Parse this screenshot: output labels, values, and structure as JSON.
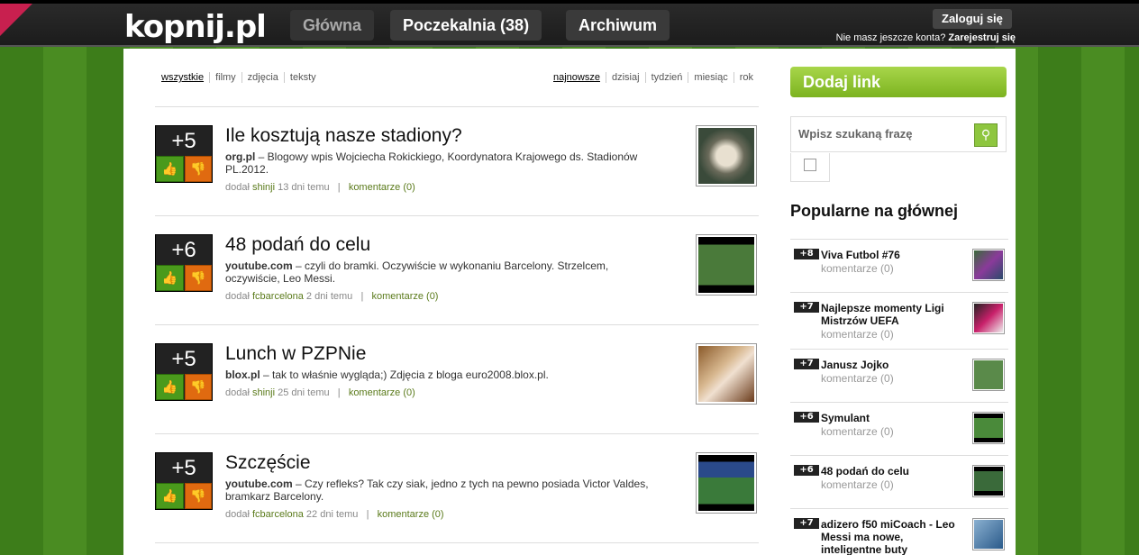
{
  "header": {
    "logo": "kopnij.pl",
    "nav": [
      "Główna",
      "Poczekalnia (38)",
      "Archiwum"
    ],
    "login": "Zaloguj się",
    "register_prefix": "Nie masz jeszcze konta?",
    "register_link": "Zarejestruj się"
  },
  "filters": {
    "type": [
      "wszystkie",
      "filmy",
      "zdjęcia",
      "teksty"
    ],
    "time": [
      "najnowsze",
      "dzisiaj",
      "tydzień",
      "miesiąc",
      "rok"
    ]
  },
  "items": [
    {
      "score": "+5",
      "title": "Ile kosztują nasze stadiony?",
      "source": "org.pl",
      "desc": " – Blogowy wpis Wojciecha Rokickiego, Koordynatora Krajowego ds. Stadionów PL.2012.",
      "added": "dodał",
      "user": "shinji",
      "when": "13 dni temu",
      "comments": "komentarze (0)"
    },
    {
      "score": "+6",
      "title": "48 podań do celu",
      "source": "youtube.com",
      "desc": " – czyli do bramki. Oczywiście w wykonaniu Barcelony. Strzelcem, oczywiście, Leo Messi.",
      "added": "dodał",
      "user": "fcbarcelona",
      "when": "2 dni temu",
      "comments": "komentarze (0)"
    },
    {
      "score": "+5",
      "title": "Lunch w PZPNie",
      "source": "blox.pl",
      "desc": " – tak to właśnie wygląda;) Zdjęcia z bloga euro2008.blox.pl.",
      "added": "dodał",
      "user": "shinji",
      "when": "25 dni temu",
      "comments": "komentarze (0)"
    },
    {
      "score": "+5",
      "title": "Szczęście",
      "source": "youtube.com",
      "desc": " – Czy refleks? Tak czy siak, jedno z tych na pewno posiada Victor Valdes, bramkarz Barcelony.",
      "added": "dodał",
      "user": "fcbarcelona",
      "when": "22 dni temu",
      "comments": "komentarze (0)"
    }
  ],
  "sidebar": {
    "add_link": "Dodaj link",
    "search_placeholder": "Wpisz szukaną frazę",
    "popular_title": "Popularne na głównej",
    "popular": [
      {
        "score": "+8",
        "title": "Viva Futbol #76",
        "comments": "komentarze (0)"
      },
      {
        "score": "+7",
        "title": "Najlepsze momenty Ligi Mistrzów UEFA",
        "comments": "komentarze (0)"
      },
      {
        "score": "+7",
        "title": "Janusz Jojko",
        "comments": "komentarze (0)"
      },
      {
        "score": "+6",
        "title": "Symulant",
        "comments": "komentarze (0)"
      },
      {
        "score": "+6",
        "title": "48 podań do celu",
        "comments": "komentarze (0)"
      },
      {
        "score": "+7",
        "title": "adizero f50 miCoach - Leo Messi ma nowe, inteligentne buty",
        "comments": ""
      }
    ]
  },
  "colors": {
    "accent_green": "#8ec63f",
    "vote_up": "#4a9a1c",
    "vote_down": "#e06a10",
    "topbar": "#222222"
  }
}
